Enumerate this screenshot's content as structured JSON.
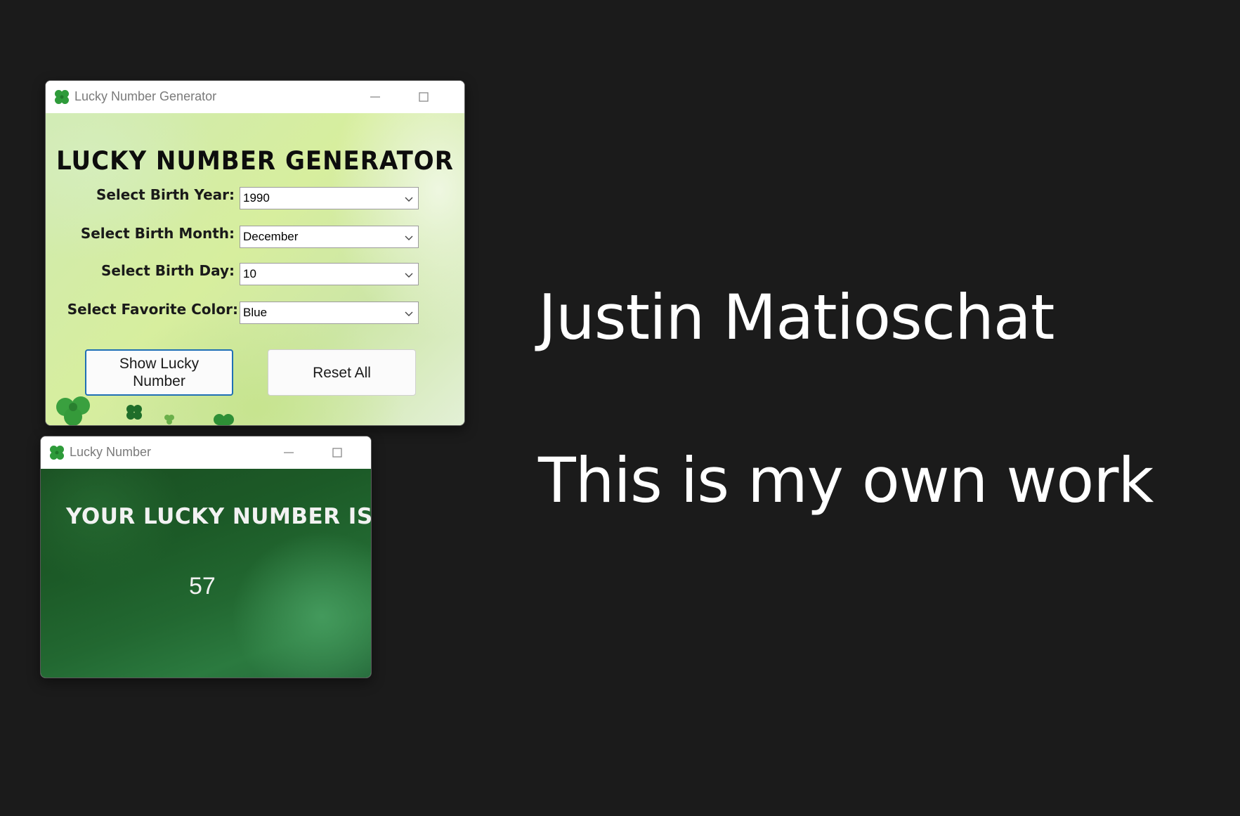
{
  "main_window": {
    "title": "Lucky Number Generator",
    "heading": "LUCKY NUMBER GENERATOR",
    "fields": {
      "year": {
        "label": "Select Birth Year:",
        "value": "1990"
      },
      "month": {
        "label": "Select Birth Month:",
        "value": "December"
      },
      "day": {
        "label": "Select Birth Day:",
        "value": "10"
      },
      "color": {
        "label": "Select Favorite Color:",
        "value": "Blue"
      }
    },
    "buttons": {
      "show": "Show Lucky Number",
      "reset": "Reset All"
    }
  },
  "result_window": {
    "title": "Lucky Number",
    "heading": "YOUR LUCKY NUMBER IS:",
    "number": "57"
  },
  "captions": {
    "name": "Justin Matioschat",
    "statement": "This is my own work"
  },
  "colors": {
    "desktop_bg": "#1b1b1b",
    "clover_green": "#2e9b3a",
    "button_focus_border": "#1f6fb5",
    "result_bg": "#1f5e2a"
  },
  "icons": {
    "app": "four-leaf-clover-icon",
    "minimize": "minimize-icon",
    "maximize": "maximize-icon",
    "close": "close-icon",
    "dropdown": "chevron-down-icon"
  }
}
